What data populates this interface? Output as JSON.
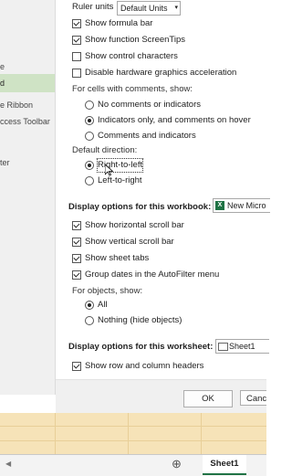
{
  "nav": {
    "items": [
      "e",
      "d",
      "e Ribbon",
      "ccess Toolbar",
      "ter"
    ],
    "selected_index": 1
  },
  "ruler": {
    "label": "Ruler units",
    "value": "Default Units"
  },
  "top_checks": [
    {
      "label": "Show formula bar",
      "checked": true
    },
    {
      "label": "Show function ScreenTips",
      "checked": true
    },
    {
      "label": "Show control characters",
      "checked": false
    },
    {
      "label": "Disable hardware graphics acceleration",
      "checked": false
    }
  ],
  "comments": {
    "heading": "For cells with comments, show:",
    "options": [
      {
        "label": "No comments or indicators",
        "selected": false
      },
      {
        "label": "Indicators only, and comments on hover",
        "selected": true
      },
      {
        "label": "Comments and indicators",
        "selected": false
      }
    ]
  },
  "direction": {
    "heading": "Default direction:",
    "options": [
      {
        "label": "Right-to-left",
        "selected": true
      },
      {
        "label": "Left-to-right",
        "selected": false
      }
    ]
  },
  "workbook": {
    "heading": "Display options for this workbook:",
    "value": "New Micro",
    "checks": [
      {
        "label": "Show horizontal scroll bar",
        "checked": true
      },
      {
        "label": "Show vertical scroll bar",
        "checked": true
      },
      {
        "label": "Show sheet tabs",
        "checked": true
      },
      {
        "label": "Group dates in the AutoFilter menu",
        "checked": true
      }
    ],
    "objects_heading": "For objects, show:",
    "objects": [
      {
        "label": "All",
        "selected": true
      },
      {
        "label": "Nothing (hide objects)",
        "selected": false
      }
    ]
  },
  "worksheet": {
    "heading": "Display options for this worksheet:",
    "value": "Sheet1",
    "checks": [
      {
        "label": "Show row and column headers",
        "checked": true
      }
    ]
  },
  "buttons": {
    "ok": "OK",
    "cancel": "Canc"
  },
  "sheet_tabs": {
    "add_icon": "⊕",
    "active_tab": "Sheet1"
  }
}
